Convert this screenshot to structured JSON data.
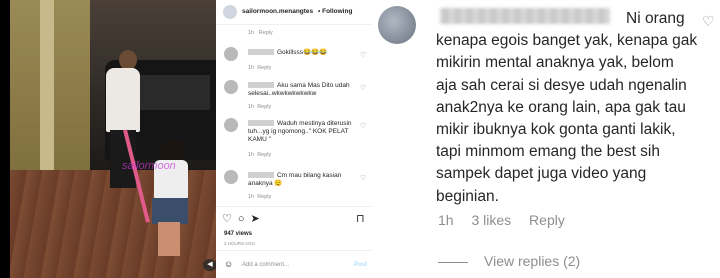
{
  "post": {
    "username": "sailormoon.menangtes",
    "follow_label": "Following",
    "more_icon": "more-dots-icon",
    "caption_age": "1h",
    "caption_reply": "Reply",
    "watermark": "sailormoon",
    "likes": "947 views",
    "posted_ago": "2 HOURS AGO",
    "add_comment_placeholder": "Add a comment...",
    "post_label": "Post"
  },
  "comments": [
    {
      "text": "Gokillsss😂😂😂",
      "age": "1h",
      "reply": "Reply"
    },
    {
      "text": "Aku sama Mas Dito udah selesai..wkwkwkwkwkw",
      "age": "1h",
      "reply": "Reply"
    },
    {
      "text": "Waduh mestinya diterusin tuh...yg ig ngomong..\" KOK PELAT KAMU \"",
      "age": "1h",
      "reply": "Reply"
    },
    {
      "text": "Cm mau bilang kasian anaknya 😟",
      "age": "1h",
      "reply": "Reply"
    }
  ],
  "zoom_comment": {
    "text": "Ni orang kenapa egois banget yak, kenapa gak mikirin mental anaknya yak, belom aja sah cerai si desye udah ngenalin anak2nya ke orang lain, apa gak tau mikir ibuknya kok gonta ganti lakik, tapi minmom emang the best sih sampek dapet juga video yang beginian.",
    "age": "1h",
    "likes": "3 likes",
    "reply": "Reply",
    "view_replies": "View replies (2)"
  },
  "colors": {
    "accent_post": "#b2dffc",
    "meta_gray": "#8e8e8e",
    "text": "#262626"
  }
}
